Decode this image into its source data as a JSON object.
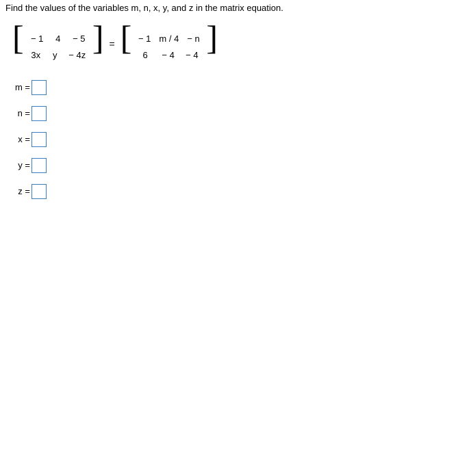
{
  "question_text": "Find the values of the variables m, n, x, y, and z in the matrix equation.",
  "matrix_left": {
    "r1c1": "− 1",
    "r1c2": "4",
    "r1c3": "− 5",
    "r2c1": "3x",
    "r2c2": "y",
    "r2c3": "− 4z"
  },
  "equals_sign": "=",
  "matrix_right": {
    "r1c1": "− 1",
    "r1c2": "m / 4",
    "r1c3": "− n",
    "r2c1": "6",
    "r2c2": "− 4",
    "r2c3": "− 4"
  },
  "answers": {
    "m_label": "m =",
    "n_label": "n =",
    "x_label": "x =",
    "y_label": "y =",
    "z_label": "z =",
    "m_value": "",
    "n_value": "",
    "x_value": "",
    "y_value": "",
    "z_value": ""
  }
}
